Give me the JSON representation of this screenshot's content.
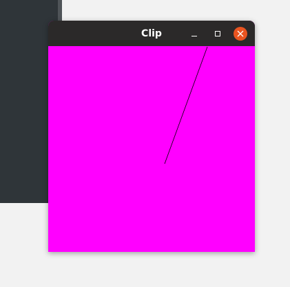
{
  "window": {
    "title": "Clip"
  },
  "colors": {
    "canvas_background": "#ff00ff",
    "titlebar": "#2b2929",
    "close_button": "#e95420",
    "line": "#000000"
  },
  "icons": {
    "minimize": "minimize-icon",
    "maximize": "maximize-icon",
    "close": "close-icon"
  }
}
